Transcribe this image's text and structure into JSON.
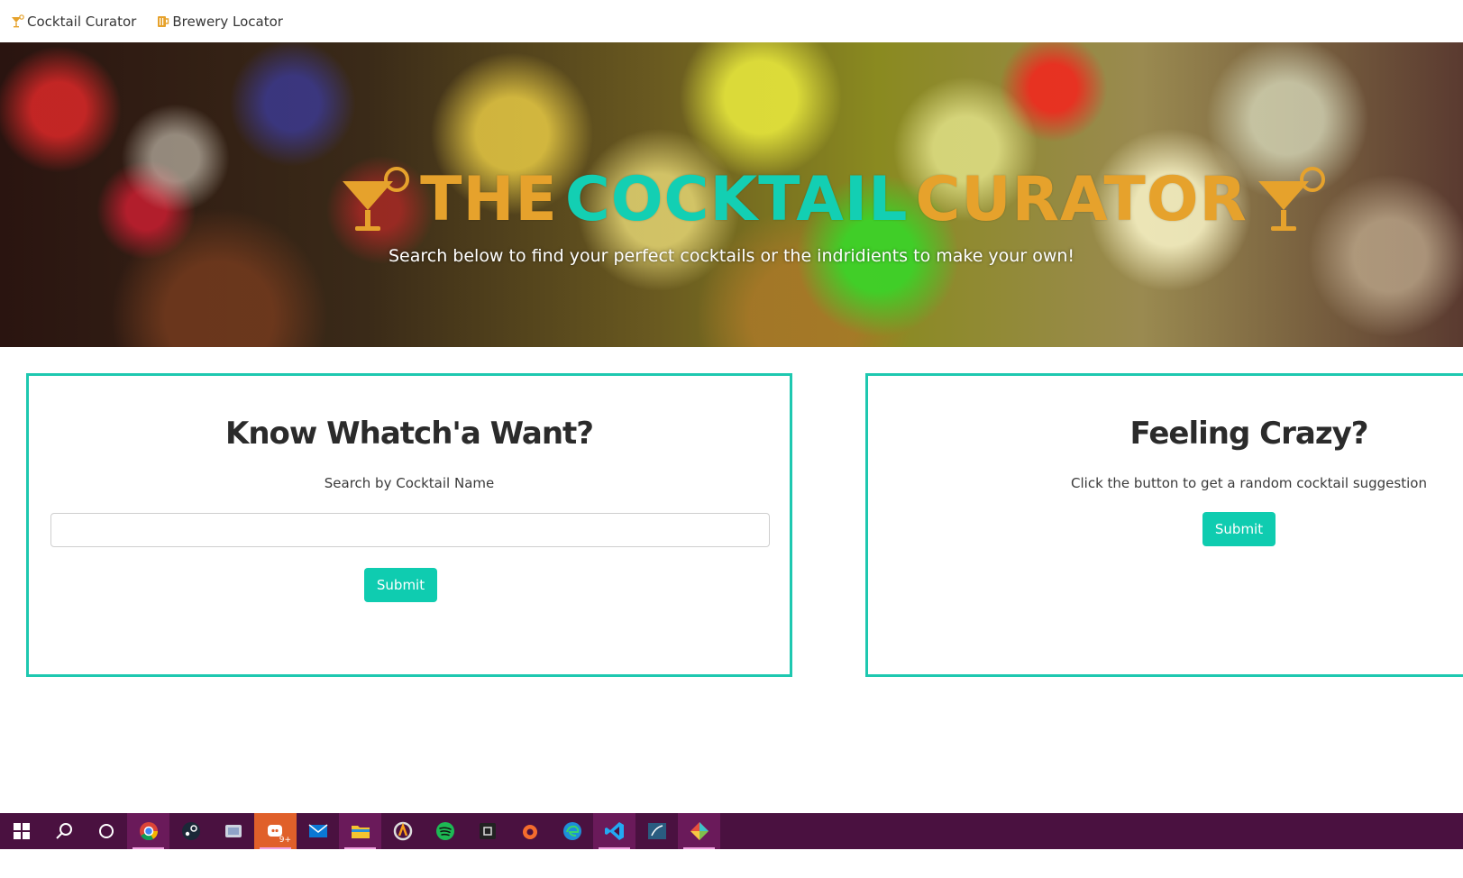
{
  "nav": {
    "items": [
      {
        "label": "Cocktail Curator",
        "icon": "cocktail-glass-icon"
      },
      {
        "label": "Brewery Locator",
        "icon": "beer-mug-icon"
      }
    ]
  },
  "hero": {
    "title_the": "THE",
    "title_cocktail": "COCKTAIL",
    "title_curator": "CURATOR",
    "subtitle": "Search below to find your perfect cocktails or the indridients to make your own!"
  },
  "search_card": {
    "heading": "Know Whatch'a Want?",
    "description": "Search by Cocktail Name",
    "input_value": "",
    "input_placeholder": "",
    "submit_label": "Submit"
  },
  "random_card": {
    "heading": "Feeling Crazy?",
    "description": "Click the button to get a random cocktail suggestion",
    "submit_label": "Submit"
  },
  "taskbar": {
    "apps": [
      "windows-start-icon",
      "search-icon",
      "cortana-icon",
      "chrome-icon",
      "steam-icon",
      "snip-icon",
      "discord-icon",
      "mail-icon",
      "file-explorer-icon",
      "overwatch-icon",
      "spotify-icon",
      "terminal-icon",
      "origin-icon",
      "edge-icon",
      "vscode-icon",
      "mysql-icon",
      "git-kraken-icon"
    ],
    "discord_badge": "9+"
  },
  "colors": {
    "accent_teal": "#13cfb3",
    "accent_gold": "#e6a22c",
    "taskbar": "#4a1140"
  }
}
